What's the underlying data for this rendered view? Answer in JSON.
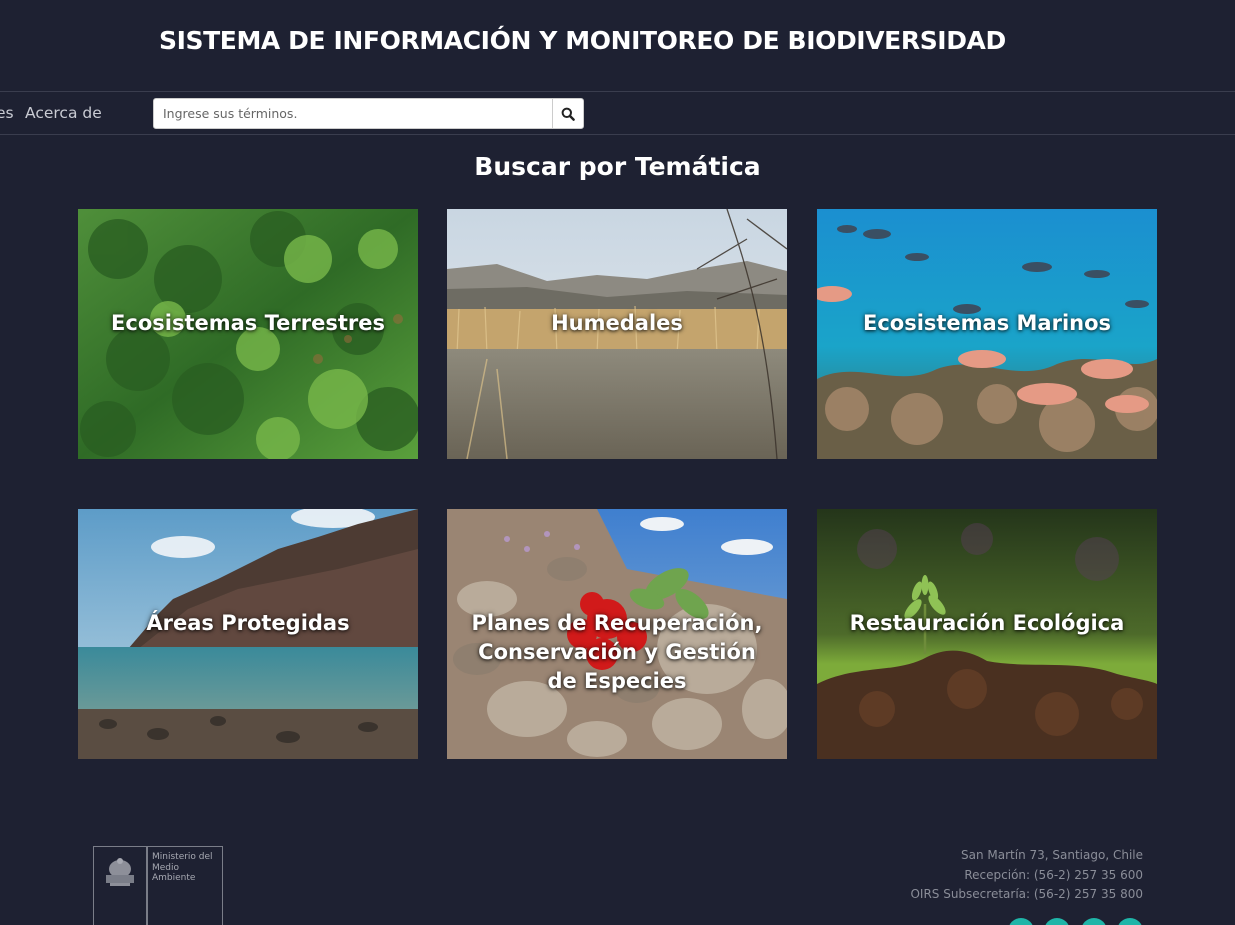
{
  "header": {
    "title": "SISTEMA DE INFORMACIÓN Y MONITOREO DE BIODIVERSIDAD"
  },
  "nav": {
    "partial_item": "es",
    "about": "Acerca de",
    "search_placeholder": "Ingrese sus términos."
  },
  "section": {
    "title": "Buscar por Temática"
  },
  "tiles": [
    {
      "label": "Ecosistemas Terrestres"
    },
    {
      "label": "Humedales"
    },
    {
      "label": "Ecosistemas Marinos"
    },
    {
      "label": "Áreas Protegidas"
    },
    {
      "label": "Planes de Recuperación, Conservación y Gestión de Especies"
    },
    {
      "label": "Restauración Ecológica"
    }
  ],
  "footer": {
    "logo_text": "Ministerio del Medio Ambiente",
    "address": "San Martín 73, Santiago, Chile",
    "reception": "Recepción: (56-2) 257 35 600",
    "oirs": "OIRS Subsecretaría: (56-2) 257 35 800"
  },
  "colors": {
    "background": "#1e2132",
    "social_accent": "#1fb5a8"
  },
  "icons": [
    "search-icon",
    "government-emblem-icon"
  ]
}
